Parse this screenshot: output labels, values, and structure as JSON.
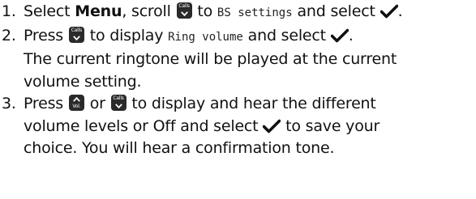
{
  "steps": [
    {
      "num": "1.",
      "parts": {
        "a": "Select ",
        "b": "Menu",
        "c": ", scroll ",
        "d": " to ",
        "e": "BS settings",
        "f": " and select "
      }
    },
    {
      "num": "2.",
      "parts": {
        "a": "Press ",
        "b": " to display ",
        "c": "Ring volume",
        "d": " and select ",
        "e": "."
      },
      "lines": [
        "The current ringtone will be played at the current",
        "volume setting."
      ]
    },
    {
      "num": "3.",
      "parts": {
        "a": "Press ",
        "b": " or ",
        "c": " to display and hear the different"
      },
      "lines": [
        "volume levels or Off and select ",
        " to save your",
        "choice. You will hear a confirmation tone."
      ]
    }
  ],
  "keys": {
    "calls": "Calls",
    "vol": "Vol."
  },
  "icons": {
    "down_key": "calls-down-key-icon",
    "up_key": "vol-up-key-icon",
    "ok": "checkmark-icon"
  },
  "colors": {
    "text": "#111111",
    "key_bg": "#2a2a2a"
  }
}
